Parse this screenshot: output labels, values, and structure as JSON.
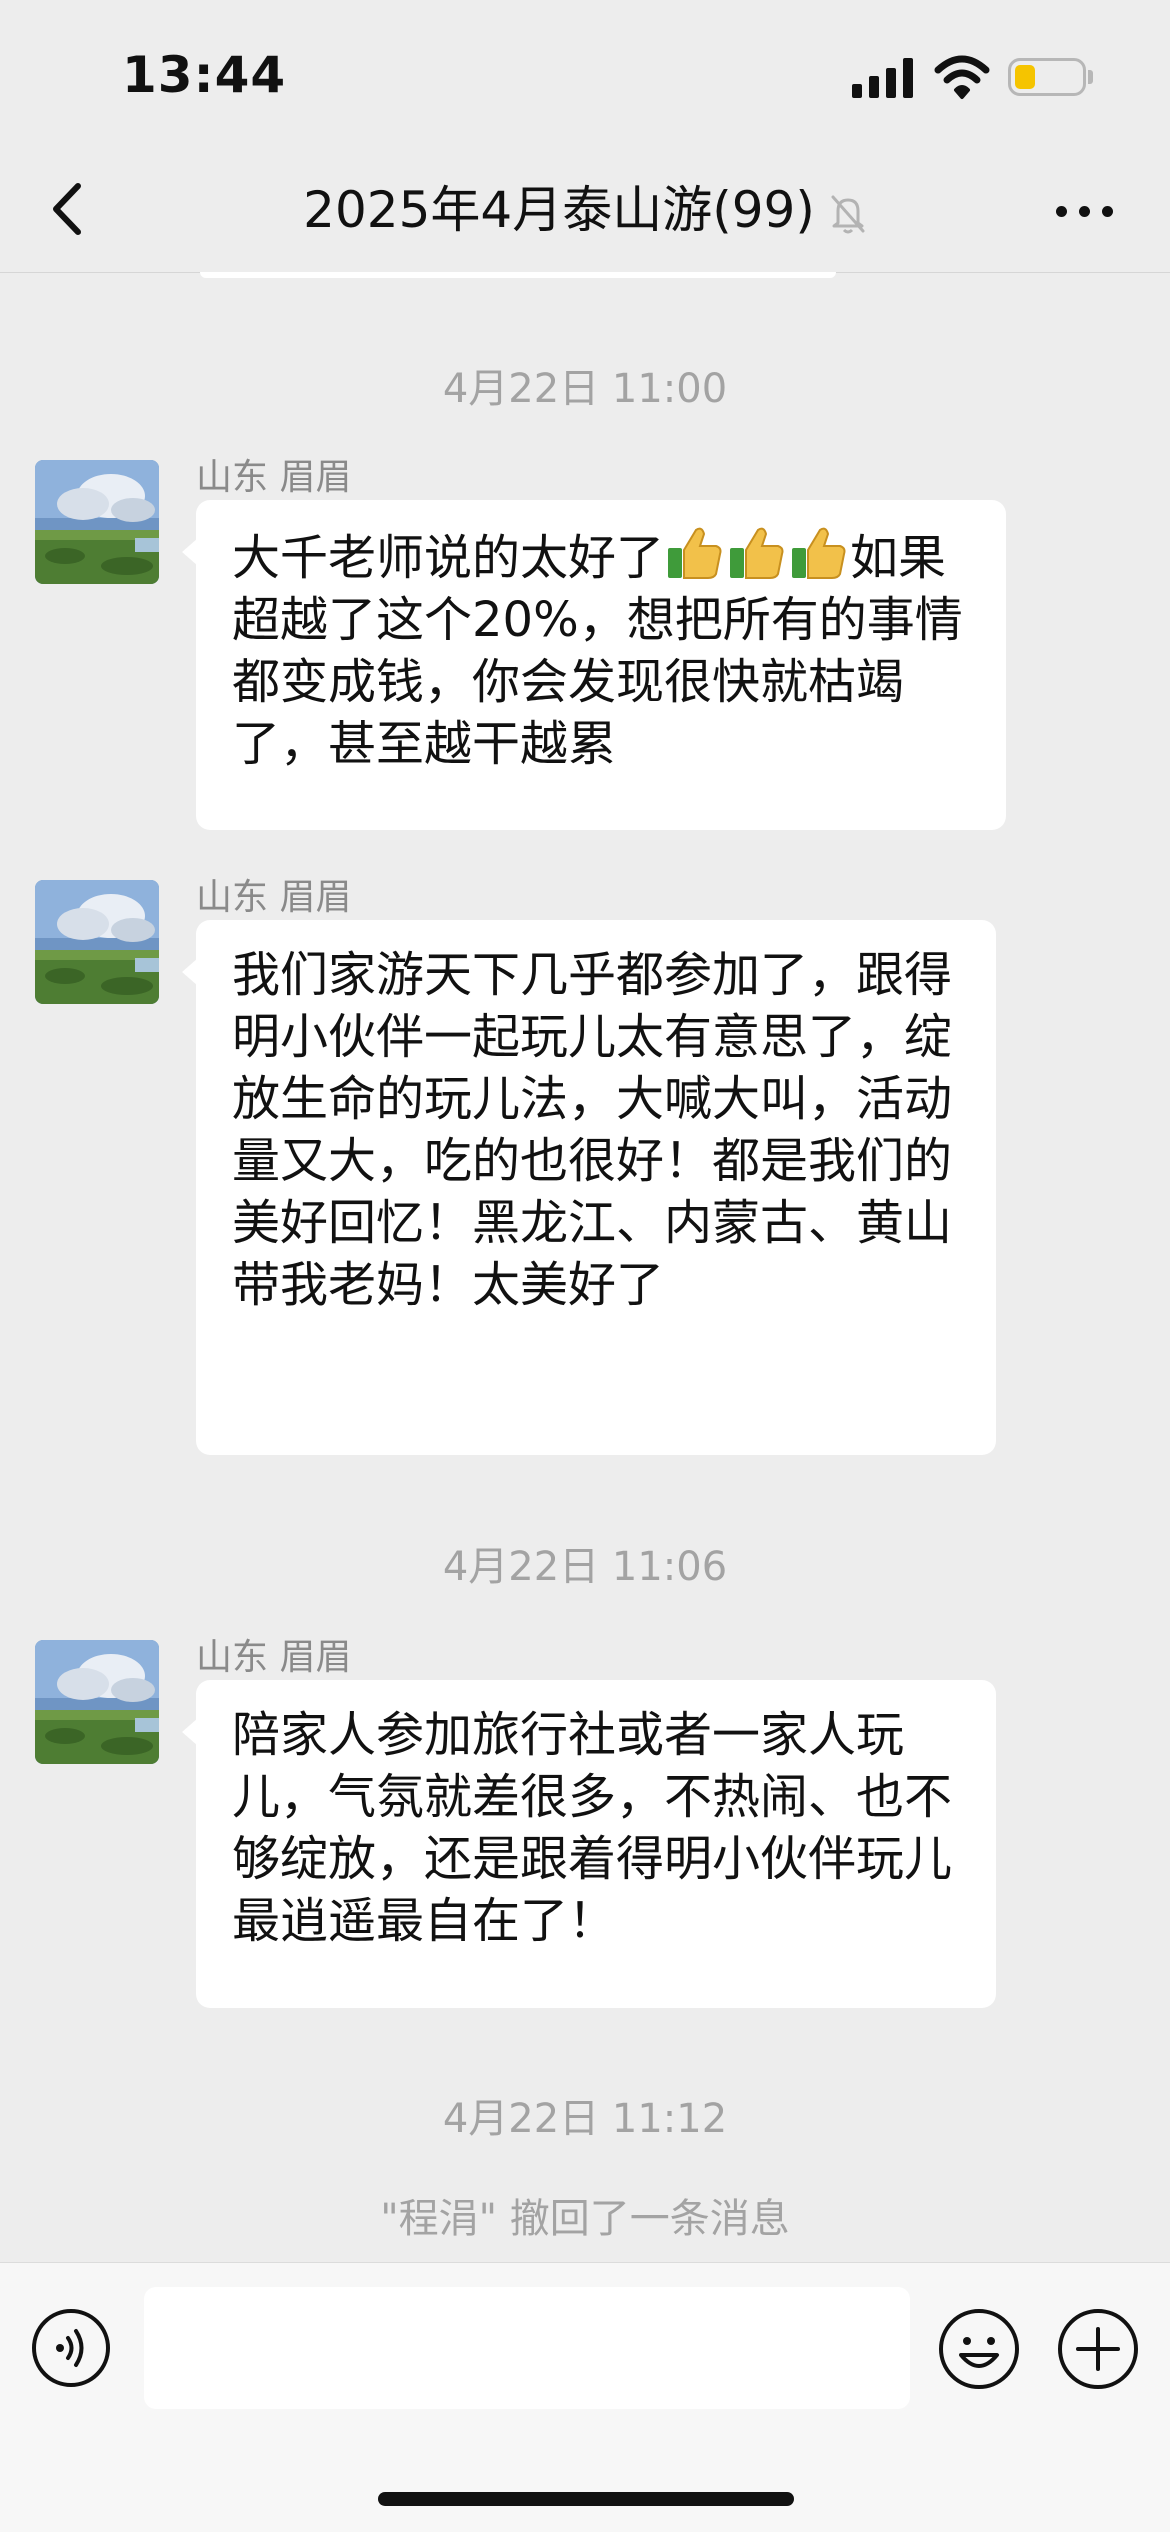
{
  "status_bar": {
    "time": "13:44",
    "battery_level": 0.3
  },
  "nav": {
    "title": "2025年4月泰山游(99)",
    "back_icon": "chevron-left-icon",
    "mute_icon": "bell-muted-icon",
    "more_icon": "more-dots-icon"
  },
  "timestamps": {
    "t1": "4月22日 11:00",
    "t2": "4月22日 11:06",
    "t3": "4月22日 11:12"
  },
  "messages": [
    {
      "sender": "山东 眉眉",
      "text_before": "大千老师说的太好了",
      "emoji": "thumbs-up-icon",
      "emoji_count": 3,
      "text_after": "如果超越了这个20%，想把所有的事情都变成钱，你会发现很快就枯竭了，甚至越干越累"
    },
    {
      "sender": "山东 眉眉",
      "text": "我们家游天下几乎都参加了，跟得明小伙伴一起玩儿太有意思了，绽放生命的玩儿法，大喊大叫，活动量又大，吃的也很好！都是我们的美好回忆！黑龙江、内蒙古、黄山带我老妈！太美好了"
    },
    {
      "sender": "山东 眉眉",
      "text": "陪家人参加旅行社或者一家人玩儿，气氛就差很多，不热闹、也不够绽放，还是跟着得明小伙伴玩儿最逍遥最自在了！"
    }
  ],
  "system_message": "\"程涓\" 撤回了一条消息",
  "input_bar": {
    "voice_icon": "voice-icon",
    "input_value": "",
    "emoji_icon": "emoji-icon",
    "plus_icon": "plus-circle-icon"
  }
}
